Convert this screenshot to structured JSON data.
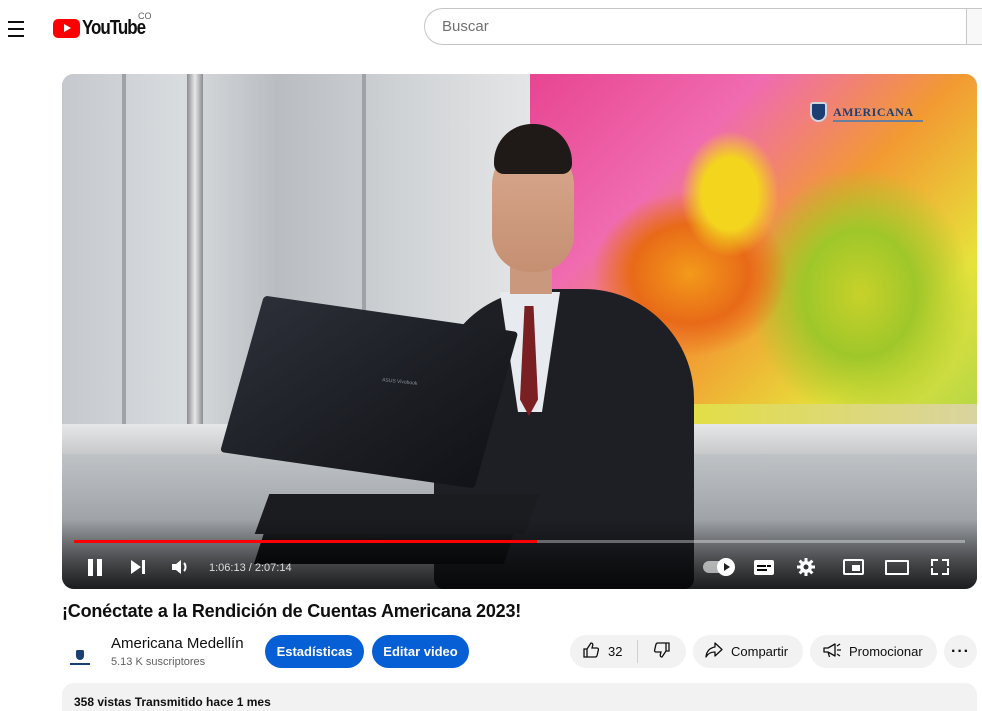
{
  "header": {
    "logo_text": "YouTube",
    "country_code": "CO",
    "search_placeholder": "Buscar"
  },
  "player": {
    "overlay_brand": "AMERICANA",
    "laptop_brand": "ASUS Vivobook",
    "current_time": "1:06:13",
    "duration": "2:07:14",
    "time_display": "1:06:13 / 2:07:14",
    "progress_fraction": 0.52,
    "playing": true,
    "autoplay_on": true,
    "colors": {
      "progress": "#ff0000"
    }
  },
  "video": {
    "title": "¡Conéctate a la Rendición de Cuentas Americana 2023!",
    "views": "358 vistas",
    "streamed": "Transmitido hace 1 mes",
    "meta_line": "358 vistas  Transmitido hace 1 mes"
  },
  "channel": {
    "name": "Americana Medellín",
    "subscribers": "5.13 K suscriptores"
  },
  "actions": {
    "stats_label": "Estadísticas",
    "edit_label": "Editar video",
    "like_count": "32",
    "share_label": "Compartir",
    "promote_label": "Promocionar",
    "more_label": "···"
  },
  "colors": {
    "accent_blue": "#065fd4",
    "brand_red": "#ff0000",
    "pill_bg": "#f2f2f2"
  },
  "icons": [
    "menu-icon",
    "youtube-logo-icon",
    "pause-icon",
    "next-icon",
    "volume-icon",
    "autoplay-toggle-icon",
    "subtitles-icon",
    "settings-gear-icon",
    "miniplayer-icon",
    "theater-mode-icon",
    "fullscreen-icon",
    "like-icon",
    "dislike-icon",
    "share-icon",
    "promote-icon",
    "more-icon"
  ]
}
